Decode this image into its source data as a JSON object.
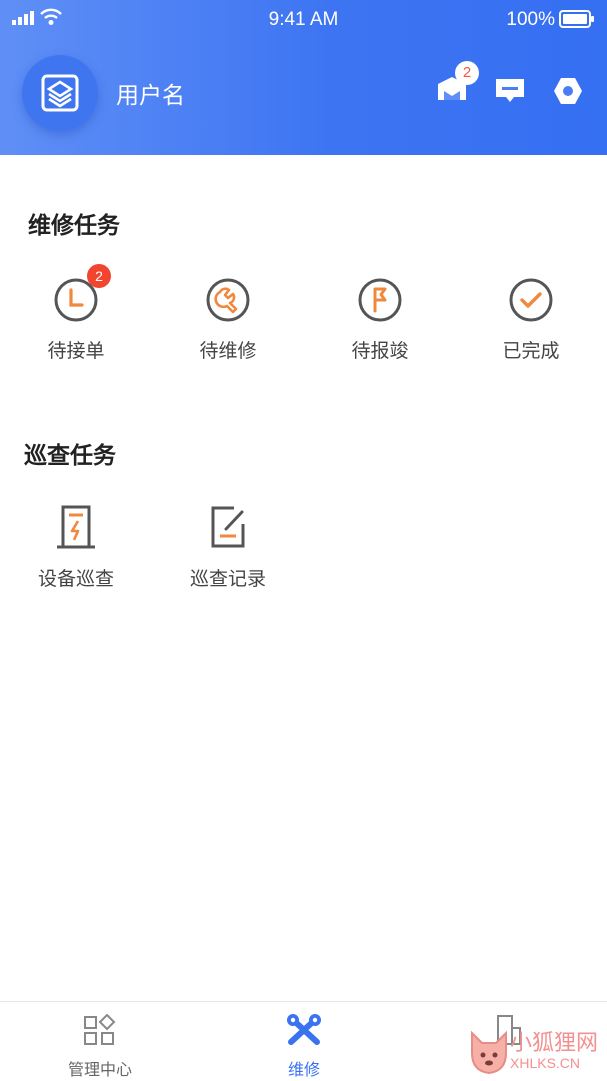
{
  "status_bar": {
    "time": "9:41 AM",
    "battery": "100%"
  },
  "header": {
    "username": "用户名",
    "notification_badge": "2"
  },
  "repair_section": {
    "title": "维修任务",
    "items": [
      {
        "label": "待接单",
        "icon": "clock-icon",
        "badge": "2"
      },
      {
        "label": "待维修",
        "icon": "wrench-icon"
      },
      {
        "label": "待报竣",
        "icon": "flag-icon"
      },
      {
        "label": "已完成",
        "icon": "check-icon"
      }
    ]
  },
  "inspection_section": {
    "title": "巡查任务",
    "items": [
      {
        "label": "设备巡查",
        "icon": "device-power-icon"
      },
      {
        "label": "巡查记录",
        "icon": "edit-record-icon"
      }
    ]
  },
  "tabbar": {
    "tabs": [
      {
        "label": "管理中心",
        "icon": "grid-icon",
        "active": false
      },
      {
        "label": "维修",
        "icon": "tools-icon",
        "active": true
      },
      {
        "label": "",
        "icon": "building-icon",
        "active": false
      }
    ]
  },
  "watermark": {
    "line1": "小狐狸网",
    "line2": "XHLKS.CN"
  },
  "colors": {
    "primary": "#3d74f2",
    "accent": "#f0883e",
    "badge": "#f1452f"
  }
}
